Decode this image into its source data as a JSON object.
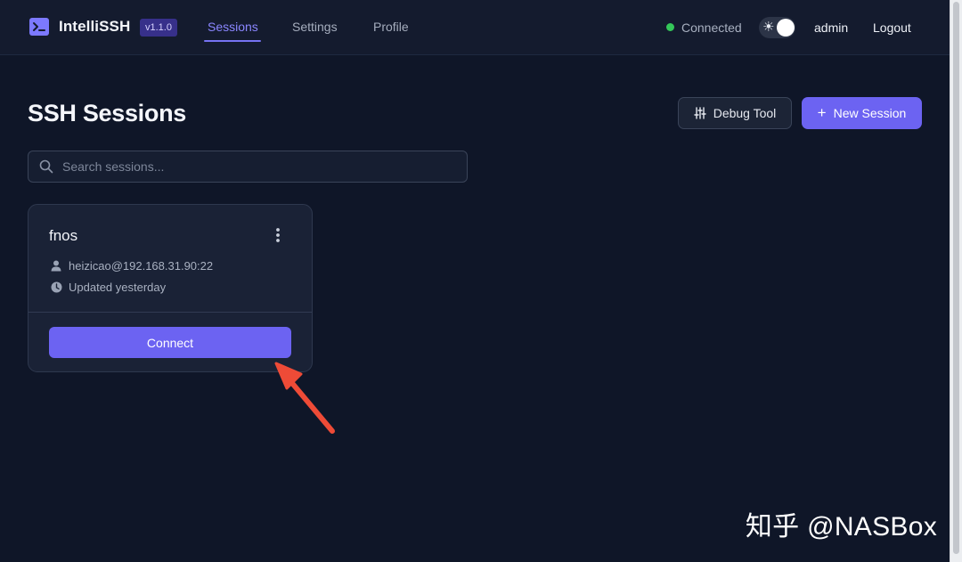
{
  "header": {
    "app_name": "IntelliSSH",
    "version": "v1.1.0",
    "nav": [
      {
        "label": "Sessions",
        "active": true
      },
      {
        "label": "Settings",
        "active": false
      },
      {
        "label": "Profile",
        "active": false
      }
    ],
    "connection_status": "Connected",
    "theme_icon": "sun-icon",
    "username": "admin",
    "logout_label": "Logout"
  },
  "main": {
    "title": "SSH Sessions",
    "debug_button_label": "Debug Tool",
    "new_session_label": "New Session",
    "search_placeholder": "Search sessions..."
  },
  "sessions": [
    {
      "name": "fnos",
      "user_host": "heizicao@192.168.31.90:22",
      "updated": "Updated yesterday",
      "connect_label": "Connect"
    }
  ],
  "watermark": "知乎 @NASBox",
  "colors": {
    "accent": "#6c63f2",
    "background": "#0f1628",
    "card": "#1a2236",
    "status_green": "#34c759",
    "annotation_arrow": "#ee4b37"
  }
}
